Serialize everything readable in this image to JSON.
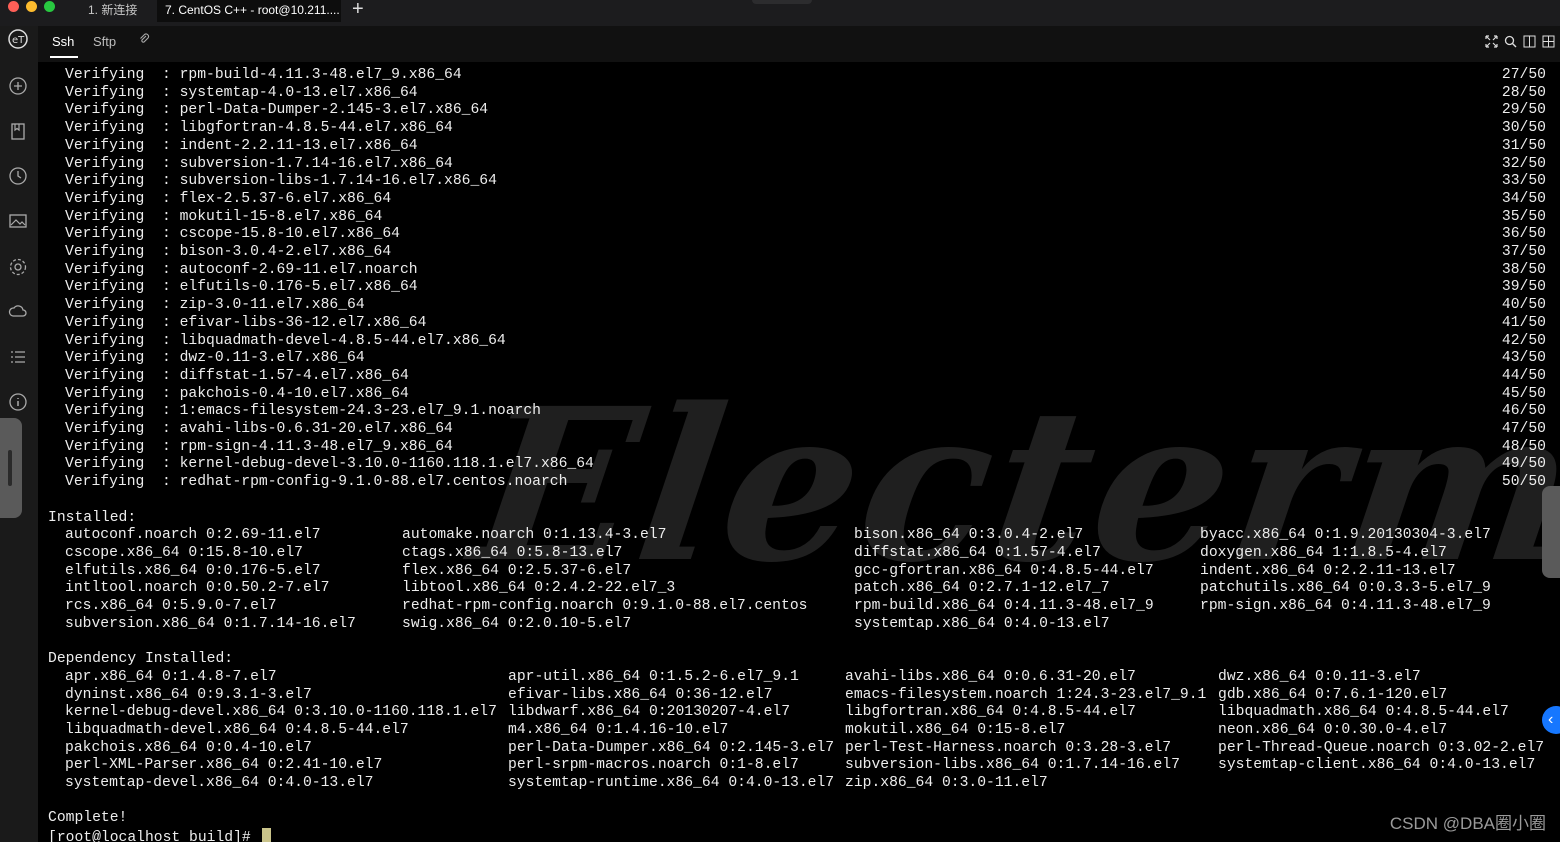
{
  "window": {
    "tabs": [
      {
        "label": "1. 新连接"
      },
      {
        "label": "7. CentOS C++ - root@10.211...."
      }
    ],
    "add_tab": "+"
  },
  "session_tabs": {
    "ssh": "Ssh",
    "sftp": "Sftp"
  },
  "sidebar": {
    "icons": [
      "electerm-logo-icon",
      "add-icon",
      "bookmark-icon",
      "history-icon",
      "image-icon",
      "settings-icon",
      "cloud-sync-icon",
      "list-icon",
      "info-icon"
    ]
  },
  "terminal": {
    "watermark": "Electerm",
    "verifying": [
      {
        "pkg": "rpm-build-4.11.3-48.el7_9.x86_64",
        "count": "27/50"
      },
      {
        "pkg": "systemtap-4.0-13.el7.x86_64",
        "count": "28/50"
      },
      {
        "pkg": "perl-Data-Dumper-2.145-3.el7.x86_64",
        "count": "29/50"
      },
      {
        "pkg": "libgfortran-4.8.5-44.el7.x86_64",
        "count": "30/50"
      },
      {
        "pkg": "indent-2.2.11-13.el7.x86_64",
        "count": "31/50"
      },
      {
        "pkg": "subversion-1.7.14-16.el7.x86_64",
        "count": "32/50"
      },
      {
        "pkg": "subversion-libs-1.7.14-16.el7.x86_64",
        "count": "33/50"
      },
      {
        "pkg": "flex-2.5.37-6.el7.x86_64",
        "count": "34/50"
      },
      {
        "pkg": "mokutil-15-8.el7.x86_64",
        "count": "35/50"
      },
      {
        "pkg": "cscope-15.8-10.el7.x86_64",
        "count": "36/50"
      },
      {
        "pkg": "bison-3.0.4-2.el7.x86_64",
        "count": "37/50"
      },
      {
        "pkg": "autoconf-2.69-11.el7.noarch",
        "count": "38/50"
      },
      {
        "pkg": "elfutils-0.176-5.el7.x86_64",
        "count": "39/50"
      },
      {
        "pkg": "zip-3.0-11.el7.x86_64",
        "count": "40/50"
      },
      {
        "pkg": "efivar-libs-36-12.el7.x86_64",
        "count": "41/50"
      },
      {
        "pkg": "libquadmath-devel-4.8.5-44.el7.x86_64",
        "count": "42/50"
      },
      {
        "pkg": "dwz-0.11-3.el7.x86_64",
        "count": "43/50"
      },
      {
        "pkg": "diffstat-1.57-4.el7.x86_64",
        "count": "44/50"
      },
      {
        "pkg": "pakchois-0.4-10.el7.x86_64",
        "count": "45/50"
      },
      {
        "pkg": "1:emacs-filesystem-24.3-23.el7_9.1.noarch",
        "count": "46/50"
      },
      {
        "pkg": "avahi-libs-0.6.31-20.el7.x86_64",
        "count": "47/50"
      },
      {
        "pkg": "rpm-sign-4.11.3-48.el7_9.x86_64",
        "count": "48/50"
      },
      {
        "pkg": "kernel-debug-devel-3.10.0-1160.118.1.el7.x86_64",
        "count": "49/50"
      },
      {
        "pkg": "redhat-rpm-config-9.1.0-88.el7.centos.noarch",
        "count": "50/50"
      }
    ],
    "verifying_label": "Verifying  : ",
    "installed_header": "Installed:",
    "installed": [
      [
        "autoconf.noarch 0:2.69-11.el7",
        "automake.noarch 0:1.13.4-3.el7",
        "bison.x86_64 0:3.0.4-2.el7",
        "byacc.x86_64 0:1.9.20130304-3.el7"
      ],
      [
        "cscope.x86_64 0:15.8-10.el7",
        "ctags.x86_64 0:5.8-13.el7",
        "diffstat.x86_64 0:1.57-4.el7",
        "doxygen.x86_64 1:1.8.5-4.el7"
      ],
      [
        "elfutils.x86_64 0:0.176-5.el7",
        "flex.x86_64 0:2.5.37-6.el7",
        "gcc-gfortran.x86_64 0:4.8.5-44.el7",
        "indent.x86_64 0:2.2.11-13.el7"
      ],
      [
        "intltool.noarch 0:0.50.2-7.el7",
        "libtool.x86_64 0:2.4.2-22.el7_3",
        "patch.x86_64 0:2.7.1-12.el7_7",
        "patchutils.x86_64 0:0.3.3-5.el7_9"
      ],
      [
        "rcs.x86_64 0:5.9.0-7.el7",
        "redhat-rpm-config.noarch 0:9.1.0-88.el7.centos",
        "rpm-build.x86_64 0:4.11.3-48.el7_9",
        "rpm-sign.x86_64 0:4.11.3-48.el7_9"
      ],
      [
        "subversion.x86_64 0:1.7.14-16.el7",
        "swig.x86_64 0:2.0.10-5.el7",
        "systemtap.x86_64 0:4.0-13.el7",
        ""
      ]
    ],
    "dependency_header": "Dependency Installed:",
    "dependency": [
      [
        "apr.x86_64 0:1.4.8-7.el7",
        "apr-util.x86_64 0:1.5.2-6.el7_9.1",
        "avahi-libs.x86_64 0:0.6.31-20.el7",
        "dwz.x86_64 0:0.11-3.el7"
      ],
      [
        "dyninst.x86_64 0:9.3.1-3.el7",
        "efivar-libs.x86_64 0:36-12.el7",
        "emacs-filesystem.noarch 1:24.3-23.el7_9.1",
        "gdb.x86_64 0:7.6.1-120.el7"
      ],
      [
        "kernel-debug-devel.x86_64 0:3.10.0-1160.118.1.el7",
        "libdwarf.x86_64 0:20130207-4.el7",
        "libgfortran.x86_64 0:4.8.5-44.el7",
        "libquadmath.x86_64 0:4.8.5-44.el7"
      ],
      [
        "libquadmath-devel.x86_64 0:4.8.5-44.el7",
        "m4.x86_64 0:1.4.16-10.el7",
        "mokutil.x86_64 0:15-8.el7",
        "neon.x86_64 0:0.30.0-4.el7"
      ],
      [
        "pakchois.x86_64 0:0.4-10.el7",
        "perl-Data-Dumper.x86_64 0:2.145-3.el7",
        "perl-Test-Harness.noarch 0:3.28-3.el7",
        "perl-Thread-Queue.noarch 0:3.02-2.el7"
      ],
      [
        "perl-XML-Parser.x86_64 0:2.41-10.el7",
        "perl-srpm-macros.noarch 0:1-8.el7",
        "subversion-libs.x86_64 0:1.7.14-16.el7",
        "systemtap-client.x86_64 0:4.0-13.el7"
      ],
      [
        "systemtap-devel.x86_64 0:4.0-13.el7",
        "systemtap-runtime.x86_64 0:4.0-13.el7",
        "zip.x86_64 0:3.0-11.el7",
        ""
      ]
    ],
    "complete": "Complete!",
    "prompt": "[root@localhost build]# "
  },
  "overlay": {
    "csdn_watermark": "CSDN @DBA圈小圈"
  },
  "colors": {
    "background": "#000000",
    "text": "#ededed",
    "cursor": "#c9c38a",
    "accent_blue": "#1677ff"
  }
}
